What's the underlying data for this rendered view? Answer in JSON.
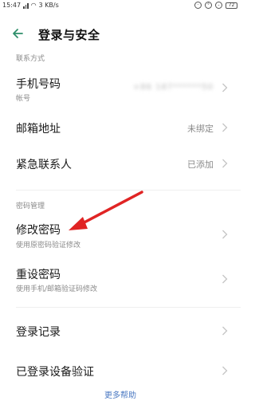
{
  "status_bar": {
    "time": "15:47",
    "network_speed": "3 KB/s",
    "battery": "72"
  },
  "header": {
    "title": "登录与安全"
  },
  "contact_section": {
    "label": "联系方式",
    "phone": {
      "title": "手机号码",
      "subtitle": "帐号",
      "value": "+86 187******50"
    },
    "email": {
      "title": "邮箱地址",
      "value": "未绑定"
    },
    "emergency": {
      "title": "紧急联系人",
      "value": "已添加"
    }
  },
  "password_section": {
    "label": "密码管理",
    "change_password": {
      "title": "修改密码",
      "subtitle": "使用原密码验证修改"
    },
    "reset_password": {
      "title": "重设密码",
      "subtitle": "使用手机/邮箱验证码修改"
    }
  },
  "other_rows": {
    "login_records": "登录记录",
    "device_verification": "已登录设备验证"
  },
  "footer": {
    "more_help": "更多帮助"
  },
  "colors": {
    "accent_green": "#2f8f6b",
    "arrow_red": "#e02424",
    "link_blue": "#4a78c2"
  }
}
